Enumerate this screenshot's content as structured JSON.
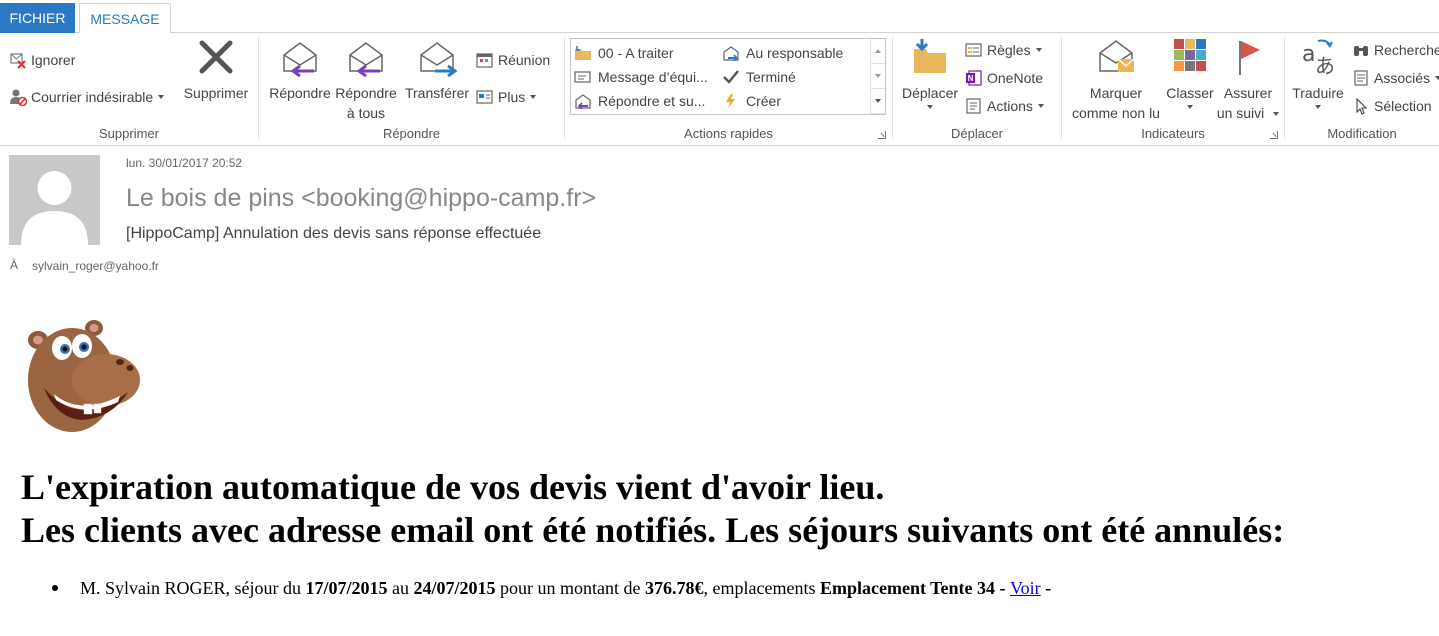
{
  "tabs": [
    {
      "label": "FICHIER",
      "active": false
    },
    {
      "label": "MESSAGE",
      "active": true
    }
  ],
  "ribbon": {
    "delete_group": {
      "label": "Supprimer",
      "ignore": "Ignorer",
      "junk": "Courrier indésirable",
      "delete": "Supprimer"
    },
    "respond_group": {
      "label": "Répondre",
      "reply": "Répondre",
      "reply_all_line1": "Répondre",
      "reply_all_line2": "à tous",
      "forward": "Transférer",
      "meeting": "Réunion",
      "more": "Plus"
    },
    "quick_steps_group": {
      "label": "Actions rapides",
      "items": [
        "00 - A traiter",
        "Message d’équi...",
        "Répondre et su...",
        "Au responsable",
        "Terminé",
        "Créer"
      ]
    },
    "move_group": {
      "label": "Déplacer",
      "move": "Déplacer",
      "rules": "Règles",
      "onenote": "OneNote",
      "actions": "Actions"
    },
    "tags_group": {
      "label": "Indicateurs",
      "mark_unread_line1": "Marquer",
      "mark_unread_line2": "comme non lu",
      "categorize": "Classer",
      "follow_up_line1": "Assurer",
      "follow_up_line2": "un suivi"
    },
    "editing_group": {
      "label": "Modification",
      "translate": "Traduire",
      "find": "Recherche",
      "related": "Associés",
      "select": "Sélection"
    }
  },
  "message": {
    "date": "lun. 30/01/2017 20:52",
    "sender": "Le bois de pins <booking@hippo-camp.fr>",
    "subject": "[HippoCamp] Annulation des devis sans réponse effectuée",
    "to_label": "À",
    "to_address": "sylvain_roger@yahoo.fr"
  },
  "body": {
    "headline_line1": "L'expiration automatique de vos devis vient d'avoir lieu.",
    "headline_line2": "Les clients avec adresse email ont été notifiés. Les séjours suivants ont été annulés:",
    "items": [
      {
        "client": "M. Sylvain ROGER, séjour du ",
        "start": "17/07/2015",
        "to_word": " au ",
        "end": "24/07/2015",
        "amount_prefix": " pour un montant de ",
        "amount": "376.78€",
        "locations_prefix": ", emplacements ",
        "location": "Emplacement Tente 34",
        "sep1": " - ",
        "link": "Voir",
        "sep2": " -"
      }
    ]
  },
  "colors": {
    "accent": "#2b78c5",
    "link": "#0000ee"
  }
}
